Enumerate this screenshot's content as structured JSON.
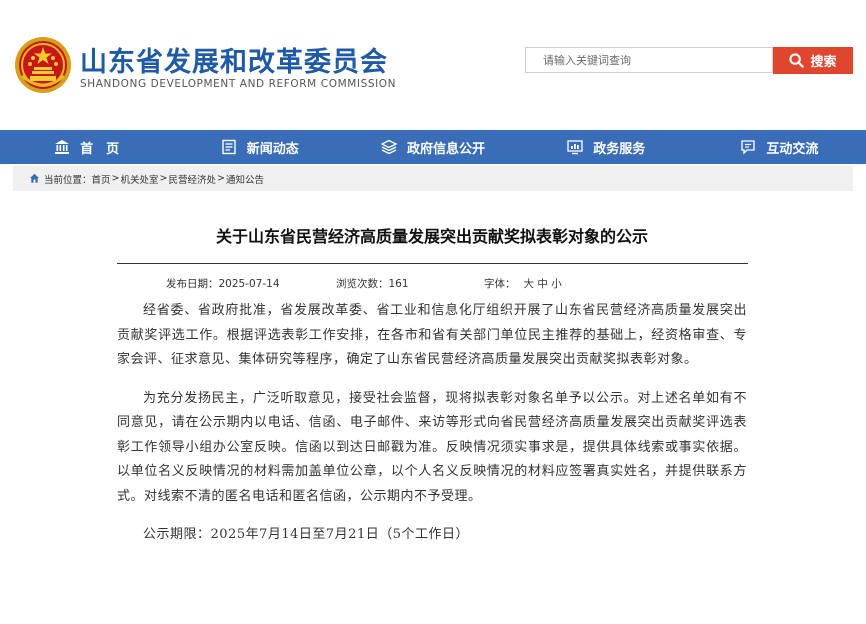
{
  "header": {
    "title_cn": "山东省发展和改革委员会",
    "title_en": "SHANDONG DEVELOPMENT AND REFORM COMMISSION",
    "emblem_icon": "national-emblem-icon",
    "search": {
      "placeholder": "请输入关键词查询",
      "button_label": "搜索",
      "button_icon": "search-icon"
    }
  },
  "nav": {
    "items": [
      {
        "label": "首　页",
        "icon": "bank-icon"
      },
      {
        "label": "新闻动态",
        "icon": "news-icon"
      },
      {
        "label": "政府信息公开",
        "icon": "layers-icon"
      },
      {
        "label": "政务服务",
        "icon": "monitor-chart-icon"
      },
      {
        "label": "互动交流",
        "icon": "chat-icon"
      }
    ]
  },
  "breadcrumb": {
    "prefix": "当前位置：",
    "items": [
      "首页",
      "机关处室",
      "民营经济处",
      "通知公告"
    ],
    "separator": ">"
  },
  "article": {
    "title": "关于山东省民营经济高质量发展突出贡献奖拟表彰对象的公示",
    "meta": {
      "date_label": "发布日期：",
      "date": "2025-07-14",
      "views_label": "浏览次数：",
      "views": "161",
      "font_label": "字体：",
      "font_sizes": [
        "大",
        "中",
        "小"
      ]
    },
    "paragraphs": [
      "经省委、省政府批准，省发展改革委、省工业和信息化厅组织开展了山东省民营经济高质量发展突出贡献奖评选工作。根据评选表彰工作安排，在各市和省有关部门单位民主推荐的基础上，经资格审查、专家会评、征求意见、集体研究等程序，确定了山东省民营经济高质量发展突出贡献奖拟表彰对象。",
      "为充分发扬民主，广泛听取意见，接受社会监督，现将拟表彰对象名单予以公示。对上述名单如有不同意见，请在公示期内以电话、信函、电子邮件、来访等形式向省民营经济高质量发展突出贡献奖评选表彰工作领导小组办公室反映。信函以到达日邮戳为准。反映情况须实事求是，提供具体线索或事实依据。以单位名义反映情况的材料需加盖单位公章，以个人名义反映情况的材料应签署真实姓名，并提供联系方式。对线索不清的匿名电话和匿名信函，公示期内不予受理。"
    ],
    "notice_period": "公示期限：2025年7月14日至7月21日（5个工作日）"
  },
  "colors": {
    "brand_blue": "#1f5aa6",
    "nav_blue": "#3a6db8",
    "search_red": "#e0452e"
  }
}
